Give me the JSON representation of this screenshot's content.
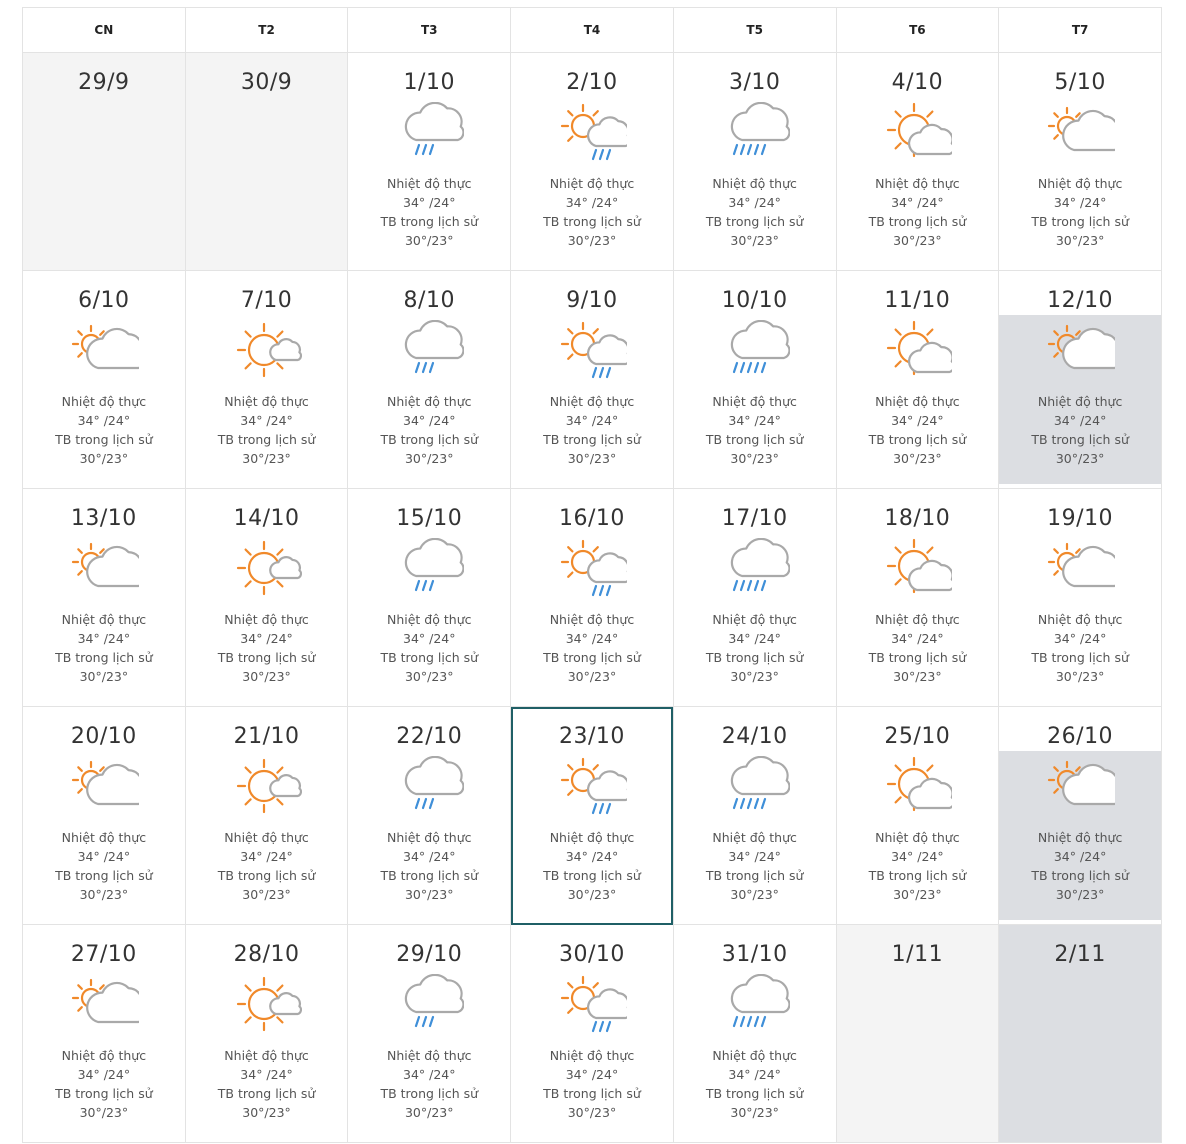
{
  "calendar": {
    "weekdays": [
      "CN",
      "T2",
      "T3",
      "T4",
      "T5",
      "T6",
      "T7"
    ],
    "labels": {
      "actual_label": "Nhiệt độ thực",
      "history_label": "TB trong lịch sử"
    },
    "colors": {
      "sun": "#f0892a",
      "cloud": "#a9a9a9",
      "rain": "#3f8fd8",
      "shade": "#dcdee2",
      "today_border": "#1f5f66"
    },
    "weeks": [
      [
        {
          "date": "29/9",
          "empty": true
        },
        {
          "date": "30/9",
          "empty": true
        },
        {
          "date": "1/10",
          "icon": "rain-cloud-icon",
          "actual": "34°  /24°",
          "history": "30°/23°"
        },
        {
          "date": "2/10",
          "icon": "sun-cloud-rain-icon",
          "actual": "34°  /24°",
          "history": "30°/23°"
        },
        {
          "date": "3/10",
          "icon": "heavy-rain-cloud-icon",
          "actual": "34°  /24°",
          "history": "30°/23°"
        },
        {
          "date": "4/10",
          "icon": "sunny-cloud-icon",
          "actual": "34°  /24°",
          "history": "30°/23°"
        },
        {
          "date": "5/10",
          "icon": "cloudy-sun-icon",
          "actual": "34°  /24°",
          "history": "30°/23°"
        }
      ],
      [
        {
          "date": "6/10",
          "icon": "cloudy-sun-icon",
          "actual": "34°  /24°",
          "history": "30°/23°"
        },
        {
          "date": "7/10",
          "icon": "sun-small-cloud-icon",
          "actual": "34°  /24°",
          "history": "30°/23°"
        },
        {
          "date": "8/10",
          "icon": "rain-cloud-icon",
          "actual": "34°  /24°",
          "history": "30°/23°"
        },
        {
          "date": "9/10",
          "icon": "sun-cloud-rain-icon",
          "actual": "34°  /24°",
          "history": "30°/23°"
        },
        {
          "date": "10/10",
          "icon": "heavy-rain-cloud-icon",
          "actual": "34°  /24°",
          "history": "30°/23°"
        },
        {
          "date": "11/10",
          "icon": "sunny-cloud-icon",
          "actual": "34°  /24°",
          "history": "30°/23°"
        },
        {
          "date": "12/10",
          "icon": "cloudy-sun-icon",
          "actual": "34°  /24°",
          "history": "30°/23°",
          "shaded": true
        }
      ],
      [
        {
          "date": "13/10",
          "icon": "cloudy-sun-icon",
          "actual": "34°  /24°",
          "history": "30°/23°"
        },
        {
          "date": "14/10",
          "icon": "sun-small-cloud-icon",
          "actual": "34°  /24°",
          "history": "30°/23°"
        },
        {
          "date": "15/10",
          "icon": "rain-cloud-icon",
          "actual": "34°  /24°",
          "history": "30°/23°"
        },
        {
          "date": "16/10",
          "icon": "sun-cloud-rain-icon",
          "actual": "34°  /24°",
          "history": "30°/23°"
        },
        {
          "date": "17/10",
          "icon": "heavy-rain-cloud-icon",
          "actual": "34°  /24°",
          "history": "30°/23°"
        },
        {
          "date": "18/10",
          "icon": "sunny-cloud-icon",
          "actual": "34°  /24°",
          "history": "30°/23°"
        },
        {
          "date": "19/10",
          "icon": "cloudy-sun-icon",
          "actual": "34°  /24°",
          "history": "30°/23°"
        }
      ],
      [
        {
          "date": "20/10",
          "icon": "cloudy-sun-icon",
          "actual": "34°  /24°",
          "history": "30°/23°"
        },
        {
          "date": "21/10",
          "icon": "sun-small-cloud-icon",
          "actual": "34°  /24°",
          "history": "30°/23°"
        },
        {
          "date": "22/10",
          "icon": "rain-cloud-icon",
          "actual": "34°  /24°",
          "history": "30°/23°"
        },
        {
          "date": "23/10",
          "icon": "sun-cloud-rain-icon",
          "actual": "34°  /24°",
          "history": "30°/23°",
          "today": true
        },
        {
          "date": "24/10",
          "icon": "heavy-rain-cloud-icon",
          "actual": "34°  /24°",
          "history": "30°/23°"
        },
        {
          "date": "25/10",
          "icon": "sunny-cloud-icon",
          "actual": "34°  /24°",
          "history": "30°/23°"
        },
        {
          "date": "26/10",
          "icon": "cloudy-sun-icon",
          "actual": "34°  /24°",
          "history": "30°/23°",
          "shaded": true
        }
      ],
      [
        {
          "date": "27/10",
          "icon": "cloudy-sun-icon",
          "actual": "34°  /24°",
          "history": "30°/23°"
        },
        {
          "date": "28/10",
          "icon": "sun-small-cloud-icon",
          "actual": "34°  /24°",
          "history": "30°/23°"
        },
        {
          "date": "29/10",
          "icon": "rain-cloud-icon",
          "actual": "34°  /24°",
          "history": "30°/23°"
        },
        {
          "date": "30/10",
          "icon": "sun-cloud-rain-icon",
          "actual": "34°  /24°",
          "history": "30°/23°"
        },
        {
          "date": "31/10",
          "icon": "heavy-rain-cloud-icon",
          "actual": "34°  /24°",
          "history": "30°/23°"
        },
        {
          "date": "1/11",
          "empty": true
        },
        {
          "date": "2/11",
          "empty": true,
          "shaded": true
        }
      ]
    ]
  }
}
